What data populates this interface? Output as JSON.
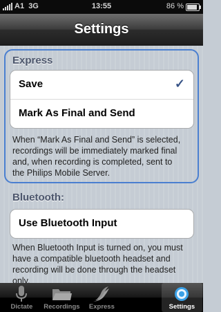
{
  "status_bar": {
    "carrier": "A1",
    "network": "3G",
    "time": "13:55",
    "battery": "86 %"
  },
  "nav": {
    "title": "Settings"
  },
  "express": {
    "header": "Express",
    "options": [
      {
        "label": "Save",
        "selected": true
      },
      {
        "label": "Mark As Final and Send",
        "selected": false
      }
    ],
    "footer_lines": [
      "When “Mark As Final and Send” is selected,",
      "recordings will be immediately marked final",
      "and, when recording is completed, sent to",
      "the Philips Mobile Server."
    ]
  },
  "bluetooth": {
    "header": "Bluetooth:",
    "option": "Use Bluetooth Input",
    "footer_lines": [
      "When Bluetooth Input is turned on, you must",
      "have a compatible bluetooth headset and",
      "recording will be done through the headset",
      "only."
    ]
  },
  "tabs": [
    {
      "label": "Dictate",
      "icon": "microphone-icon",
      "active": false
    },
    {
      "label": "Recordings",
      "icon": "folder-icon",
      "active": false
    },
    {
      "label": "Express",
      "icon": "express-icon",
      "active": false
    },
    {
      "label": "",
      "icon": "",
      "active": false
    },
    {
      "label": "Settings",
      "icon": "settings-gear-icon",
      "active": true
    }
  ],
  "colors": {
    "accent": "#4a7fd0",
    "check": "#385487",
    "tab_active": "#3aa0e6"
  }
}
